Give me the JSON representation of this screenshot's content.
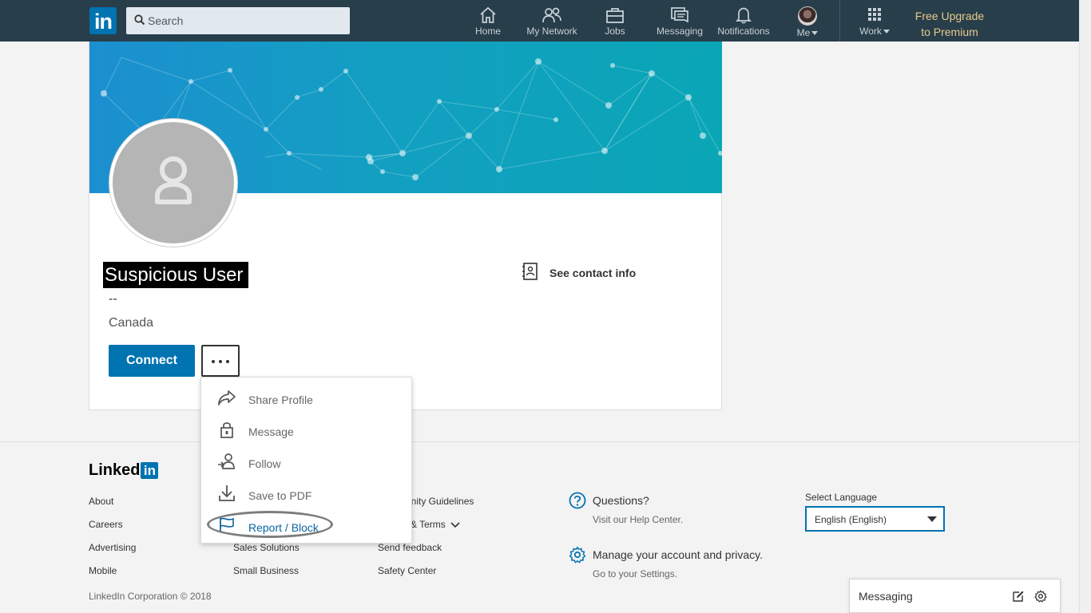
{
  "nav": {
    "logo": "in",
    "search_placeholder": "Search",
    "items": [
      {
        "label": "Home",
        "icon": "home-icon"
      },
      {
        "label": "My Network",
        "icon": "network-icon"
      },
      {
        "label": "Jobs",
        "icon": "briefcase-icon"
      },
      {
        "label": "Messaging",
        "icon": "messaging-icon"
      },
      {
        "label": "Notifications",
        "icon": "bell-icon"
      },
      {
        "label": "Me",
        "icon": "avatar"
      },
      {
        "label": "Work",
        "icon": "grid-icon"
      }
    ],
    "premium_line1": "Free Upgrade",
    "premium_line2": "to Premium"
  },
  "profile": {
    "name": "Suspicious User",
    "headline": "--",
    "location": "Canada",
    "connect_label": "Connect",
    "contact_label": "See contact info"
  },
  "menu": {
    "items": [
      {
        "label": "Share Profile",
        "icon": "share-icon"
      },
      {
        "label": "Message",
        "icon": "lock-icon"
      },
      {
        "label": "Follow",
        "icon": "follow-icon"
      },
      {
        "label": "Save to PDF",
        "icon": "download-icon"
      },
      {
        "label": "Report / Block",
        "icon": "flag-icon"
      }
    ]
  },
  "footer": {
    "logo_text": "Linked",
    "logo_in": "in",
    "col1": [
      "About",
      "Careers",
      "Advertising",
      "Mobile"
    ],
    "col2": [
      "Sales Solutions",
      "Small Business"
    ],
    "col3": [
      "unity Guidelines",
      "& Terms",
      "Send feedback",
      "Safety Center"
    ],
    "copyright": "LinkedIn Corporation © 2018",
    "questions_title": "Questions?",
    "questions_sub": "Visit our Help Center.",
    "account_title": "Manage your account and privacy.",
    "account_sub": "Go to your Settings.",
    "language_label": "Select Language",
    "language_value": "English (English)"
  },
  "messaging": {
    "label": "Messaging"
  },
  "colors": {
    "nav_bg": "#283e4a",
    "brand_blue": "#0073b1",
    "premium_gold": "#e7c98d"
  }
}
